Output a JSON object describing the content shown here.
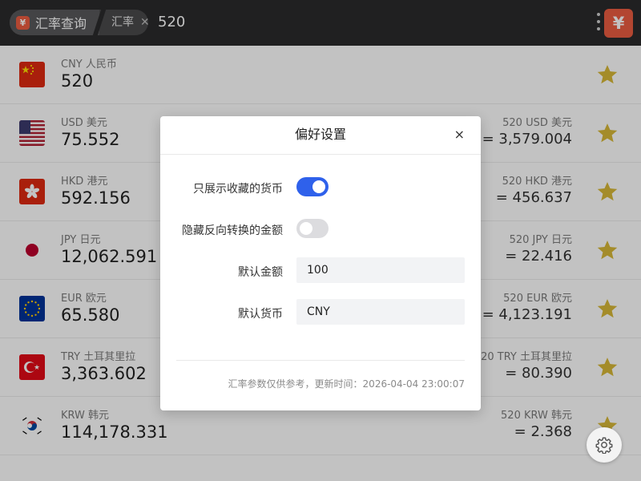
{
  "header": {
    "app_icon": "¥",
    "app_name": "汇率查询",
    "sub_tag": "汇率",
    "clear_icon": "✕",
    "query": "520",
    "logo_icon": "¥"
  },
  "currencies": [
    {
      "label": "CNY 人民币",
      "amount": "520",
      "reverse_label": "",
      "reverse_amount": ""
    },
    {
      "label": "USD 美元",
      "amount": "75.552",
      "reverse_label": "520 USD 美元",
      "reverse_amount": "= 3,579.004"
    },
    {
      "label": "HKD 港元",
      "amount": "592.156",
      "reverse_label": "520 HKD 港元",
      "reverse_amount": "= 456.637"
    },
    {
      "label": "JPY 日元",
      "amount": "12,062.591",
      "reverse_label": "520 JPY 日元",
      "reverse_amount": "= 22.416"
    },
    {
      "label": "EUR 欧元",
      "amount": "65.580",
      "reverse_label": "520 EUR 欧元",
      "reverse_amount": "= 4,123.191"
    },
    {
      "label": "TRY 土耳其里拉",
      "amount": "3,363.602",
      "reverse_label": "520 TRY 土耳其里拉",
      "reverse_amount": "= 80.390"
    },
    {
      "label": "KRW 韩元",
      "amount": "114,178.331",
      "reverse_label": "520 KRW 韩元",
      "reverse_amount": "= 2.368"
    }
  ],
  "modal": {
    "title": "偏好设置",
    "close": "×",
    "show_favorites_label": "只展示收藏的货币",
    "show_favorites_on": true,
    "hide_reverse_label": "隐藏反向转换的金额",
    "hide_reverse_on": false,
    "default_amount_label": "默认金额",
    "default_amount_value": "100",
    "default_currency_label": "默认货币",
    "default_currency_value": "CNY",
    "footer": "汇率参数仅供参考，更新时间：2026-04-04 23:00:07"
  },
  "colors": {
    "accent": "#2f61eb",
    "star": "#d8b938",
    "logo": "#ec5c41"
  }
}
